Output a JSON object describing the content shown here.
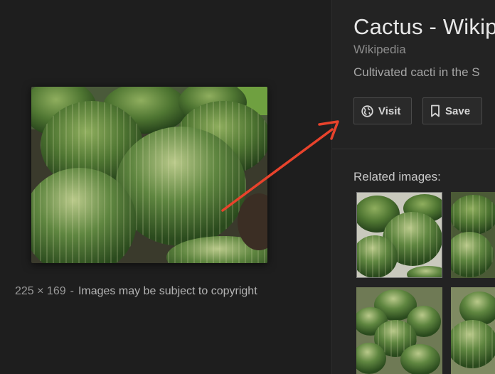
{
  "image_panel": {
    "dimensions": "225 × 169",
    "separator": "-",
    "copyright_notice": "Images may be subject to copyright"
  },
  "result": {
    "title": "Cactus - Wikipedia",
    "source": "Wikipedia",
    "description": "Cultivated cacti in the S"
  },
  "actions": {
    "visit_label": "Visit",
    "save_label": "Save"
  },
  "related": {
    "heading": "Related images:"
  },
  "colors": {
    "background": "#1f1f1f",
    "annotation_arrow": "#e8432c"
  },
  "icons": {
    "visit": "globe-icon",
    "save": "bookmark-icon"
  }
}
